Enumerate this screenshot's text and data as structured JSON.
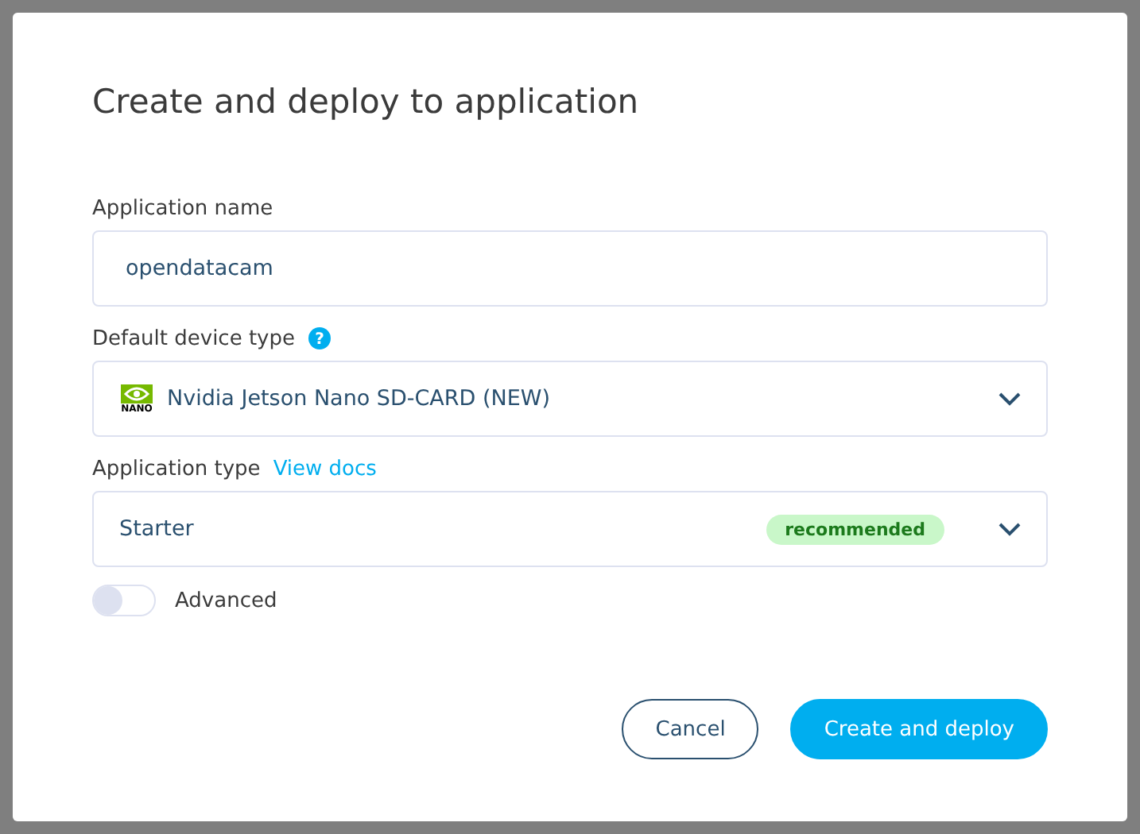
{
  "dialog": {
    "title": "Create and deploy to application"
  },
  "application_name": {
    "label": "Application name",
    "value": "opendatacam"
  },
  "device_type": {
    "label": "Default device type",
    "value": "Nvidia Jetson Nano SD-CARD (NEW)",
    "logo_text": "NANO",
    "help_icon": "?"
  },
  "application_type": {
    "label": "Application type",
    "link": "View docs",
    "value": "Starter",
    "badge": "recommended"
  },
  "advanced": {
    "label": "Advanced",
    "on": false
  },
  "buttons": [
    {
      "label": "Cancel",
      "kind": "secondary"
    },
    {
      "label": "Create and deploy",
      "kind": "primary"
    }
  ]
}
